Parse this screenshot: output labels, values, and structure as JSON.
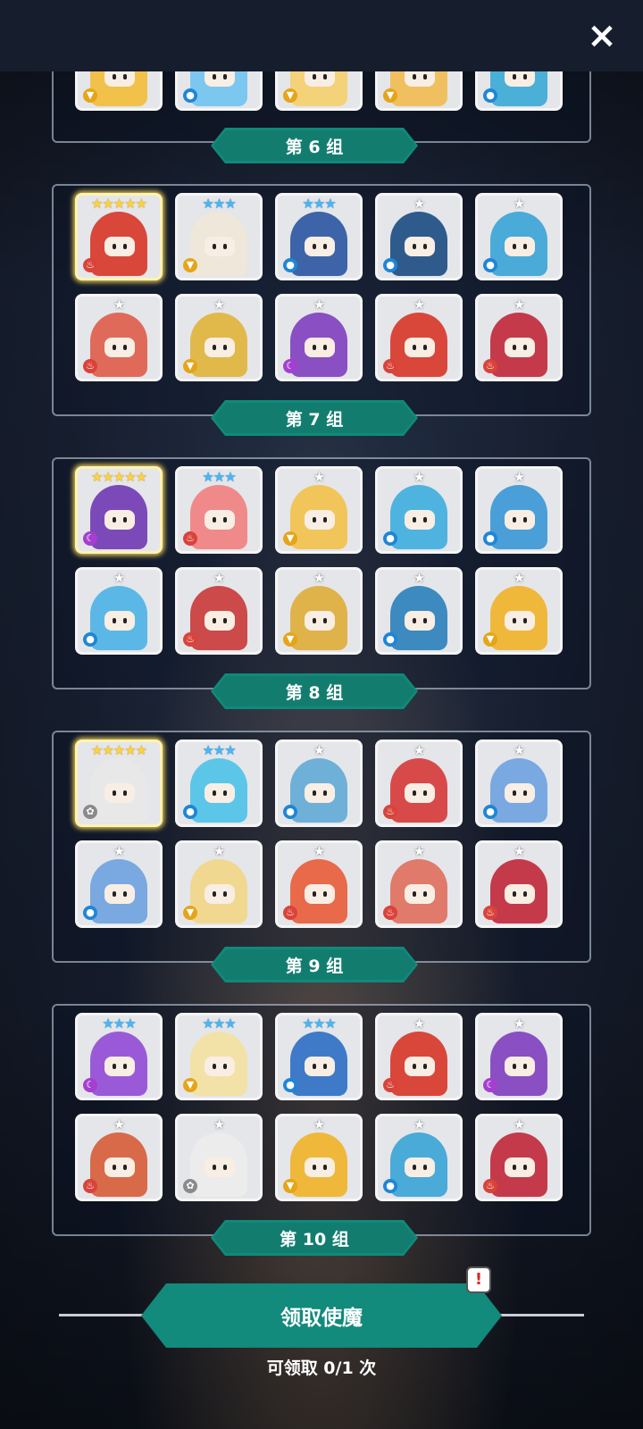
{
  "close_icon": "×",
  "groups": [
    {
      "label": "第 6 组"
    },
    {
      "label": "第 7 组"
    },
    {
      "label": "第 8 组"
    },
    {
      "label": "第 9 组"
    },
    {
      "label": "第 10 组"
    }
  ],
  "cards": {
    "group6_top_row_partial": [
      {
        "element": "light",
        "color": "#f2c14a"
      },
      {
        "element": "water",
        "color": "#7cc7ef"
      },
      {
        "element": "light",
        "color": "#f4d27a"
      },
      {
        "element": "light",
        "color": "#f0c060"
      },
      {
        "element": "water",
        "color": "#4ab0d8"
      }
    ],
    "group7": [
      {
        "stars": "★★★★★",
        "rarity": "gold",
        "element": "fire",
        "color": "#d9473a"
      },
      {
        "stars": "★★★",
        "rarity": "blue",
        "element": "light",
        "color": "#efe7d9"
      },
      {
        "stars": "★★★",
        "rarity": "blue",
        "element": "water",
        "color": "#3d64a8"
      },
      {
        "stars": "★",
        "rarity": "white",
        "element": "water",
        "color": "#2f5b8c"
      },
      {
        "stars": "★",
        "rarity": "white",
        "element": "water",
        "color": "#4aaad8"
      },
      {
        "stars": "★",
        "rarity": "white",
        "element": "fire",
        "color": "#e06a5a"
      },
      {
        "stars": "★",
        "rarity": "white",
        "element": "light",
        "color": "#e0b94a"
      },
      {
        "stars": "★",
        "rarity": "white",
        "element": "dark",
        "color": "#8a4fc2"
      },
      {
        "stars": "★",
        "rarity": "white",
        "element": "fire",
        "color": "#d9473a"
      },
      {
        "stars": "★",
        "rarity": "white",
        "element": "fire",
        "color": "#c43a4a"
      }
    ],
    "group8": [
      {
        "stars": "★★★★★",
        "rarity": "gold",
        "element": "dark",
        "color": "#7b4ab8"
      },
      {
        "stars": "★★★",
        "rarity": "blue",
        "element": "fire",
        "color": "#f08a8a"
      },
      {
        "stars": "★",
        "rarity": "white",
        "element": "light",
        "color": "#f2c55a"
      },
      {
        "stars": "★",
        "rarity": "white",
        "element": "water",
        "color": "#4fb3e0"
      },
      {
        "stars": "★",
        "rarity": "white",
        "element": "water",
        "color": "#4a9fd8"
      },
      {
        "stars": "★",
        "rarity": "white",
        "element": "water",
        "color": "#5bb8e6"
      },
      {
        "stars": "★",
        "rarity": "white",
        "element": "fire",
        "color": "#cc4a4a"
      },
      {
        "stars": "★",
        "rarity": "white",
        "element": "light",
        "color": "#e0b24a"
      },
      {
        "stars": "★",
        "rarity": "white",
        "element": "water",
        "color": "#3d8ac0"
      },
      {
        "stars": "★",
        "rarity": "white",
        "element": "light",
        "color": "#f0b83a"
      }
    ],
    "group9": [
      {
        "stars": "★★★★★",
        "rarity": "gold",
        "element": "neutral",
        "color": "#e8e8e8"
      },
      {
        "stars": "★★★",
        "rarity": "blue",
        "element": "water",
        "color": "#5cc6e8"
      },
      {
        "stars": "★",
        "rarity": "white",
        "element": "water",
        "color": "#6fb0d8"
      },
      {
        "stars": "★",
        "rarity": "white",
        "element": "fire",
        "color": "#d84a4a"
      },
      {
        "stars": "★",
        "rarity": "white",
        "element": "water",
        "color": "#7aa8e0"
      },
      {
        "stars": "★",
        "rarity": "white",
        "element": "water",
        "color": "#7aa8e0"
      },
      {
        "stars": "★",
        "rarity": "white",
        "element": "light",
        "color": "#f0d890"
      },
      {
        "stars": "★",
        "rarity": "white",
        "element": "fire",
        "color": "#e86a4a"
      },
      {
        "stars": "★",
        "rarity": "white",
        "element": "fire",
        "color": "#e07a6a"
      },
      {
        "stars": "★",
        "rarity": "white",
        "element": "fire",
        "color": "#c43a4a"
      }
    ],
    "group10": [
      {
        "stars": "★★★",
        "rarity": "blue",
        "element": "dark",
        "color": "#9a5ad8"
      },
      {
        "stars": "★★★",
        "rarity": "blue",
        "element": "light",
        "color": "#f2e2a8"
      },
      {
        "stars": "★★★",
        "rarity": "blue",
        "element": "water",
        "color": "#3f7ac8"
      },
      {
        "stars": "★",
        "rarity": "white",
        "element": "fire",
        "color": "#d9473a"
      },
      {
        "stars": "★",
        "rarity": "white",
        "element": "dark",
        "color": "#8a4fc2"
      },
      {
        "stars": "★",
        "rarity": "white",
        "element": "fire",
        "color": "#d86a4a"
      },
      {
        "stars": "★",
        "rarity": "white",
        "element": "neutral",
        "color": "#ececec"
      },
      {
        "stars": "★",
        "rarity": "white",
        "element": "light",
        "color": "#f0b83a"
      },
      {
        "stars": "★",
        "rarity": "white",
        "element": "water",
        "color": "#4aaad8"
      },
      {
        "stars": "★",
        "rarity": "white",
        "element": "fire",
        "color": "#c43a4a"
      }
    ]
  },
  "element_styles": {
    "fire": {
      "bg": "#d9433a",
      "glyph": "♨"
    },
    "water": {
      "bg": "#1f86d6",
      "glyph": "●"
    },
    "light": {
      "bg": "#e6a418",
      "glyph": "▼"
    },
    "dark": {
      "bg": "#a43fd0",
      "glyph": "☾"
    },
    "neutral": {
      "bg": "#8a8a8a",
      "glyph": "✿"
    }
  },
  "claim": {
    "button_label": "领取使魔",
    "alert_icon": "!",
    "count_text": "可领取 0/1 次"
  },
  "colors": {
    "accent_teal": "#0f8a7a",
    "gold_highlight": "#ffd23c"
  }
}
